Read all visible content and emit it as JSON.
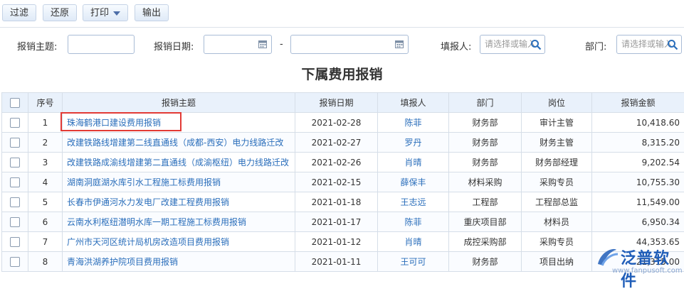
{
  "toolbar": {
    "filter": "过滤",
    "restore": "还原",
    "print": "打印",
    "export": "输出"
  },
  "filters": {
    "subject_label": "报销主题:",
    "subject_value": "",
    "date_label": "报销日期:",
    "date_from": "",
    "date_to": "",
    "date_sep": "-",
    "reporter_label": "填报人:",
    "reporter_placeholder": "请选择或输入",
    "dept_label": "部门:",
    "dept_placeholder": "请选择或输入"
  },
  "page_title": "下属费用报销",
  "table": {
    "headers": [
      "序号",
      "报销主题",
      "报销日期",
      "填报人",
      "部门",
      "岗位",
      "报销金额"
    ],
    "rows": [
      {
        "no": "1",
        "subject": "珠海鹤港口建设费用报销",
        "date": "2021-02-28",
        "reporter": "陈菲",
        "dept": "财务部",
        "post": "审计主管",
        "amount": "10,418.60"
      },
      {
        "no": "2",
        "subject": "改建铁路线增建第二线直通线（成都-西安）电力线路迁改",
        "date": "2021-02-27",
        "reporter": "罗丹",
        "dept": "财务部",
        "post": "财务主管",
        "amount": "8,315.20"
      },
      {
        "no": "3",
        "subject": "改建铁路成渝线增建第二直通线（成渝枢纽）电力线路迁改",
        "date": "2021-02-26",
        "reporter": "肖晴",
        "dept": "财务部",
        "post": "财务部经理",
        "amount": "9,202.54"
      },
      {
        "no": "4",
        "subject": "湖南洞庭湖水库引水工程施工标费用报销",
        "date": "2021-02-15",
        "reporter": "薛保丰",
        "dept": "材料采购",
        "post": "采购专员",
        "amount": "10,755.30"
      },
      {
        "no": "5",
        "subject": "长春市伊通河水力发电厂改建工程费用报销",
        "date": "2021-01-18",
        "reporter": "王志远",
        "dept": "工程部",
        "post": "工程部总监",
        "amount": "11,549.00"
      },
      {
        "no": "6",
        "subject": "云南水利枢纽潜明水库一期工程施工标费用报销",
        "date": "2021-01-17",
        "reporter": "陈菲",
        "dept": "重庆项目部",
        "post": "材料员",
        "amount": "6,950.34"
      },
      {
        "no": "7",
        "subject": "广州市天河区统计局机房改造项目费用报销",
        "date": "2021-01-12",
        "reporter": "肖晴",
        "dept": "成控采购部",
        "post": "采购专员",
        "amount": "44,353.65"
      },
      {
        "no": "8",
        "subject": "青海洪湖养护院项目费用报销",
        "date": "2021-01-11",
        "reporter": "王可可",
        "dept": "财务部",
        "post": "项目出纳",
        "amount": "21,315.00"
      }
    ]
  },
  "logo": {
    "text": "泛普软件",
    "url": "www.fanpusoft.com"
  },
  "colors": {
    "link": "#2a6ebb",
    "header_bg": "#e9f1fb",
    "highlight": "#e23a35"
  }
}
